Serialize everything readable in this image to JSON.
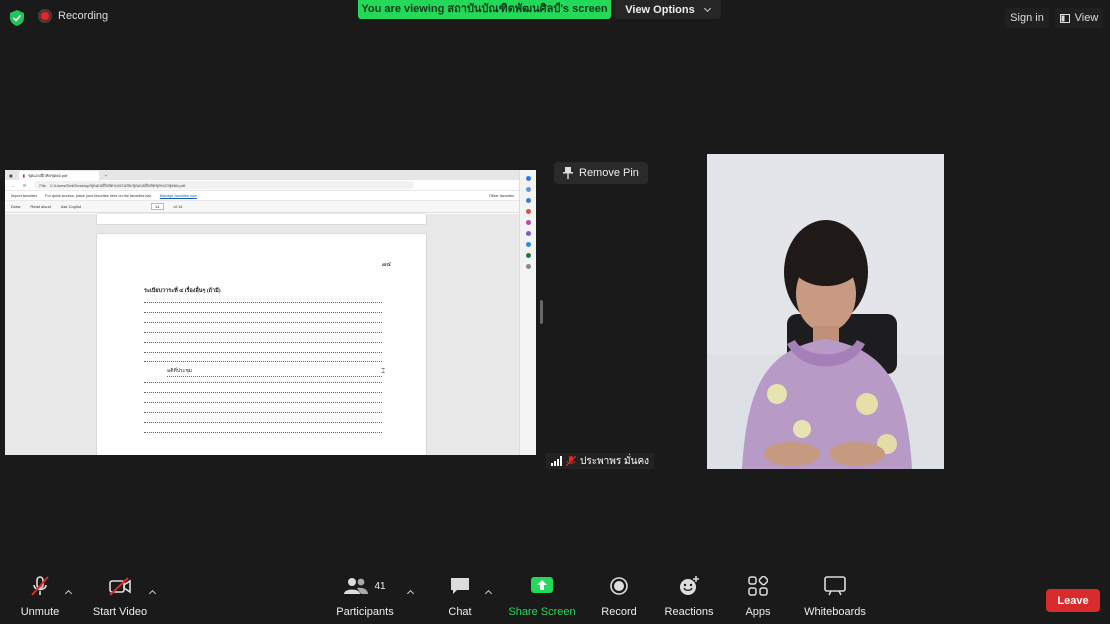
{
  "topbar": {
    "recording_label": "Recording",
    "viewing_banner": "You are viewing สถาบันบัณฑิตพัฒนศิลป์'s screen",
    "view_options_label": "View Options",
    "sign_in_label": "Sign in",
    "view_label": "View",
    "colors": {
      "banner": "#23d959",
      "record_dot": "#e02828",
      "shield": "#21c35a"
    }
  },
  "shared_screen": {
    "tab_title": "ชุดแบบฝึกหัดชุด66.pdf",
    "url_label": "File",
    "url": "C:/Users/Dell/Desktop/ชุดแบบฝึกหัด%202ฉบับ/ชุดแบบฝึกหัดชุด%20ชุด66.pdf",
    "favorites_import": "Import favorites",
    "favorites_hint": "For quick access, place your favorites here on the favorites bar.",
    "favorites_link": "Manage favorites now",
    "other_favorites": "Other favorites",
    "pdf_toolbar": {
      "draw": "Draw",
      "read_aloud": "Read aloud",
      "ask_copilot": "Ask Copilot",
      "page_current": "14",
      "page_total": "of 14"
    },
    "document": {
      "page_number": "๗๔",
      "heading": "ระเบียบวาระที่ ๔ เรื่องอื่นๆ (ถ้ามี)",
      "sign_text": "มติที่ประชุม"
    }
  },
  "remote_video": {
    "remove_pin_label": "Remove Pin",
    "participant_name": "ประพาพร มั่นคง"
  },
  "toolbar": {
    "unmute": "Unmute",
    "start_video": "Start Video",
    "participants": "Participants",
    "participants_count": "41",
    "chat": "Chat",
    "share_screen": "Share Screen",
    "record": "Record",
    "reactions": "Reactions",
    "apps": "Apps",
    "whiteboards": "Whiteboards",
    "leave": "Leave",
    "colors": {
      "share_screen": "#23d959",
      "leave": "#d92b2b",
      "muted": "#e02828"
    }
  }
}
